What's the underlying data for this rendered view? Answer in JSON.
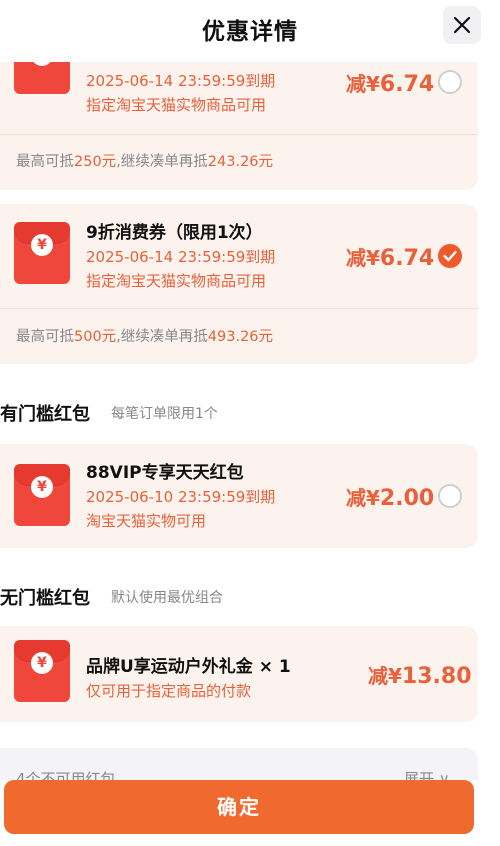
{
  "header": {
    "title": "优惠详情"
  },
  "coupons": [
    {
      "name": "",
      "expiry": "2025-06-14 23:59:59到期",
      "scope": "指定淘宝天猫实物商品可用",
      "amount_prefix": "减¥",
      "amount": "6.74",
      "selected": false,
      "footer": {
        "prefix": "最高可抵",
        "max": "250元",
        "mid": ",继续凑单再抵",
        "more": "243.26元"
      }
    },
    {
      "name": "9折消费券（限用1次）",
      "expiry": "2025-06-14 23:59:59到期",
      "scope": "指定淘宝天猫实物商品可用",
      "amount_prefix": "减¥",
      "amount": "6.74",
      "selected": true,
      "footer": {
        "prefix": "最高可抵",
        "max": "500元",
        "mid": ",继续凑单再抵",
        "more": "493.26元"
      }
    }
  ],
  "threshold_section": {
    "title": "有门槛红包",
    "subtitle": "每笔订单限用1个",
    "items": [
      {
        "name": "88VIP专享天天红包",
        "expiry": "2025-06-10 23:59:59到期",
        "scope": "淘宝天猫实物可用",
        "amount_prefix": "减¥",
        "amount": "2.00",
        "selected": false
      }
    ]
  },
  "no_threshold_section": {
    "title": "无门槛红包",
    "subtitle": "默认使用最优组合",
    "items": [
      {
        "name": "品牌U享运动户外礼金 × 1",
        "scope": "仅可用于指定商品的付款",
        "amount_prefix": "减¥",
        "amount": "13.80"
      }
    ]
  },
  "unavailable": {
    "label": "4个不可用红包",
    "toggle": "展开 ∨"
  },
  "footer": {
    "confirm_label": "确定"
  },
  "envelope_symbol": "¥",
  "colors": {
    "accent": "#e8613a",
    "button": "#f06a30",
    "envelope": "#f0473c",
    "card_bg": "#fdf3ee"
  }
}
